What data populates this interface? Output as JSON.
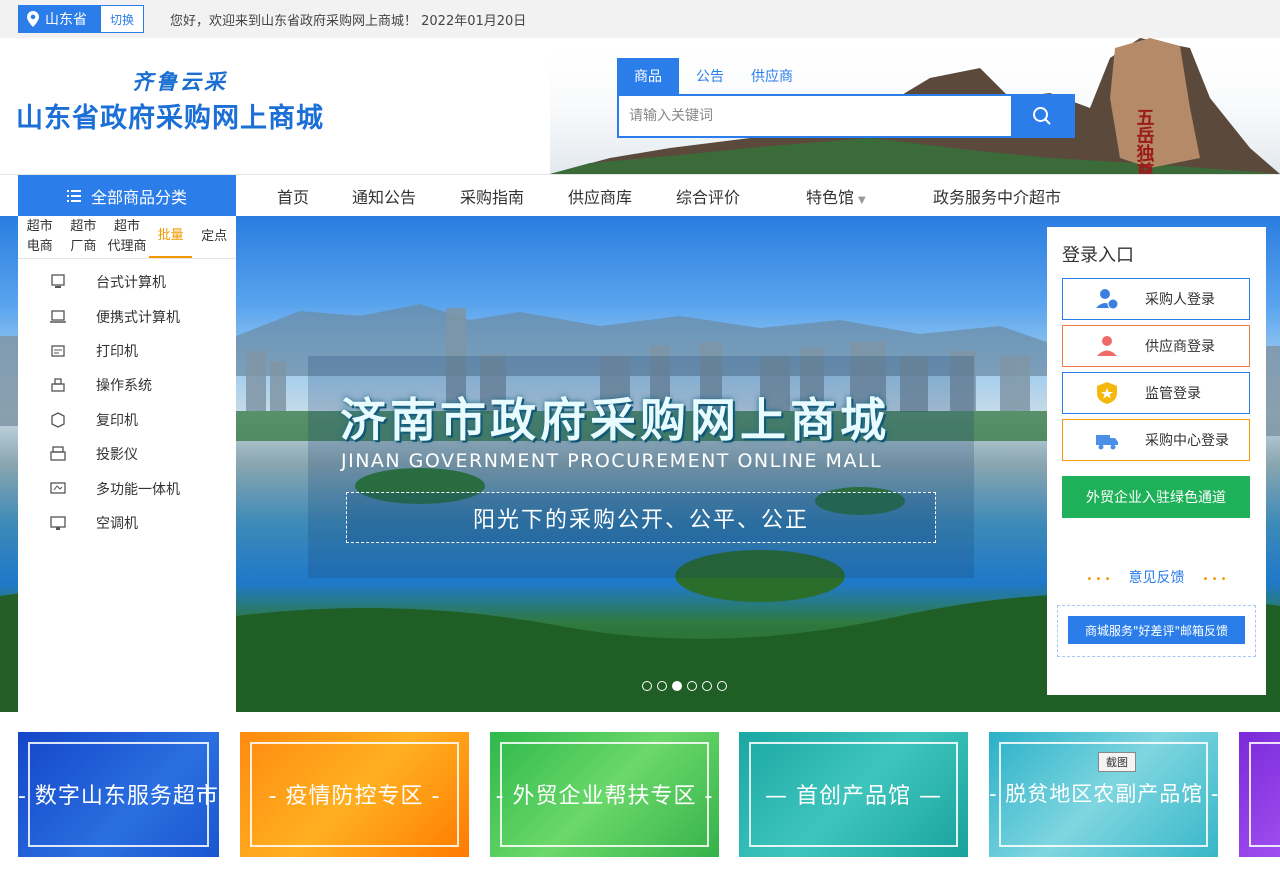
{
  "topbar": {
    "region": "山东省",
    "switch_label": "切换",
    "welcome": "您好，欢迎来到山东省政府采购网上商城！ 2022年01月20日"
  },
  "header": {
    "slogan": "齐鲁云采",
    "brand": "山东省政府采购网上商城",
    "search_tabs": [
      "商品",
      "公告",
      "供应商"
    ],
    "search_placeholder": "请输入关键词"
  },
  "nav": {
    "all_categories": "全部商品分类",
    "items": [
      "首页",
      "通知公告",
      "采购指南",
      "供应商库",
      "综合评价",
      "特色馆",
      "政务服务中介超市"
    ]
  },
  "sidebar": {
    "tabs": [
      "超市\n电商",
      "超市\n厂商",
      "超市\n代理商",
      "批量",
      "定点"
    ],
    "categories": [
      "台式计算机",
      "便携式计算机",
      "打印机",
      "操作系统",
      "复印机",
      "投影仪",
      "多功能一体机",
      "空调机"
    ]
  },
  "banner": {
    "title": "济南市政府采购网上商城",
    "subtitle": "JINAN GOVERNMENT PROCUREMENT ONLINE MALL",
    "slogan": "阳光下的采购公开、公平、公正"
  },
  "login": {
    "title": "登录入口",
    "buttons": [
      "采购人登录",
      "供应商登录",
      "监管登录",
      "采购中心登录"
    ],
    "green_channel": "外贸企业入驻绿色通道",
    "feedback": "意见反馈",
    "mail_feedback": "商城服务\"好差评\"邮箱反馈"
  },
  "cards": [
    "- 数字山东服务超市 -",
    "- 疫情防控专区 -",
    "- 外贸企业帮扶专区 -",
    "— 首创产品馆 —",
    "- 脱贫地区农副产品馆 -"
  ],
  "screenshot_tag": "截图",
  "colors": {
    "primary": "#2b7de9",
    "accent": "#f39800",
    "green": "#1fb15a"
  }
}
